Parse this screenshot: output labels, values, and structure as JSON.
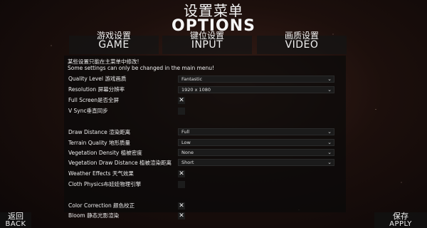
{
  "header": {
    "title_cn": "设置菜单",
    "title_en": "OPTIONS"
  },
  "tabs": [
    {
      "label_cn": "游戏设置",
      "label_en": "GAME"
    },
    {
      "label_cn": "键位设置",
      "label_en": "INPUT"
    },
    {
      "label_cn": "画质设置",
      "label_en": "VIDEO"
    }
  ],
  "notice": {
    "cn": "某些设置只能在主菜单中修改!",
    "en": "Some settings can only be changed in the main menu!"
  },
  "settings": {
    "quality_level": {
      "label": "Quality Level 游戏画质",
      "value": "Fantastic"
    },
    "resolution": {
      "label": "Resolution 屏幕分辨率",
      "value": "1920 x 1080"
    },
    "full_screen": {
      "label": "Full Screen是否全屏",
      "checked_glyph": "✕"
    },
    "vsync": {
      "label": "V Sync垂直同步",
      "checked_glyph": ""
    },
    "draw_distance": {
      "label": "Draw Distance 渲染距离",
      "value": "Full"
    },
    "terrain_quality": {
      "label": "Terrain Quality 地形质量",
      "value": "Low"
    },
    "vegetation_density": {
      "label": "Vegetation Density 植被密度",
      "value": "None"
    },
    "vegetation_draw_distance": {
      "label": "Vegetation Draw Distance 植被渲染距离",
      "value": "Short"
    },
    "weather_effects": {
      "label": "Weather Effects 天气效果",
      "checked_glyph": "✕"
    },
    "cloth_physics": {
      "label": "Cloth Physics布娃娃物理引擎",
      "checked_glyph": ""
    },
    "color_correction": {
      "label": "Color Correction 颜色校正",
      "checked_glyph": "✕"
    },
    "bloom": {
      "label": "Bloom 静态光影渲染",
      "checked_glyph": "✕"
    }
  },
  "dropdown_caret": "⌄",
  "footer": {
    "back_cn": "返回",
    "back_en": "BACK",
    "apply_cn": "保存",
    "apply_en": "APPLY"
  }
}
